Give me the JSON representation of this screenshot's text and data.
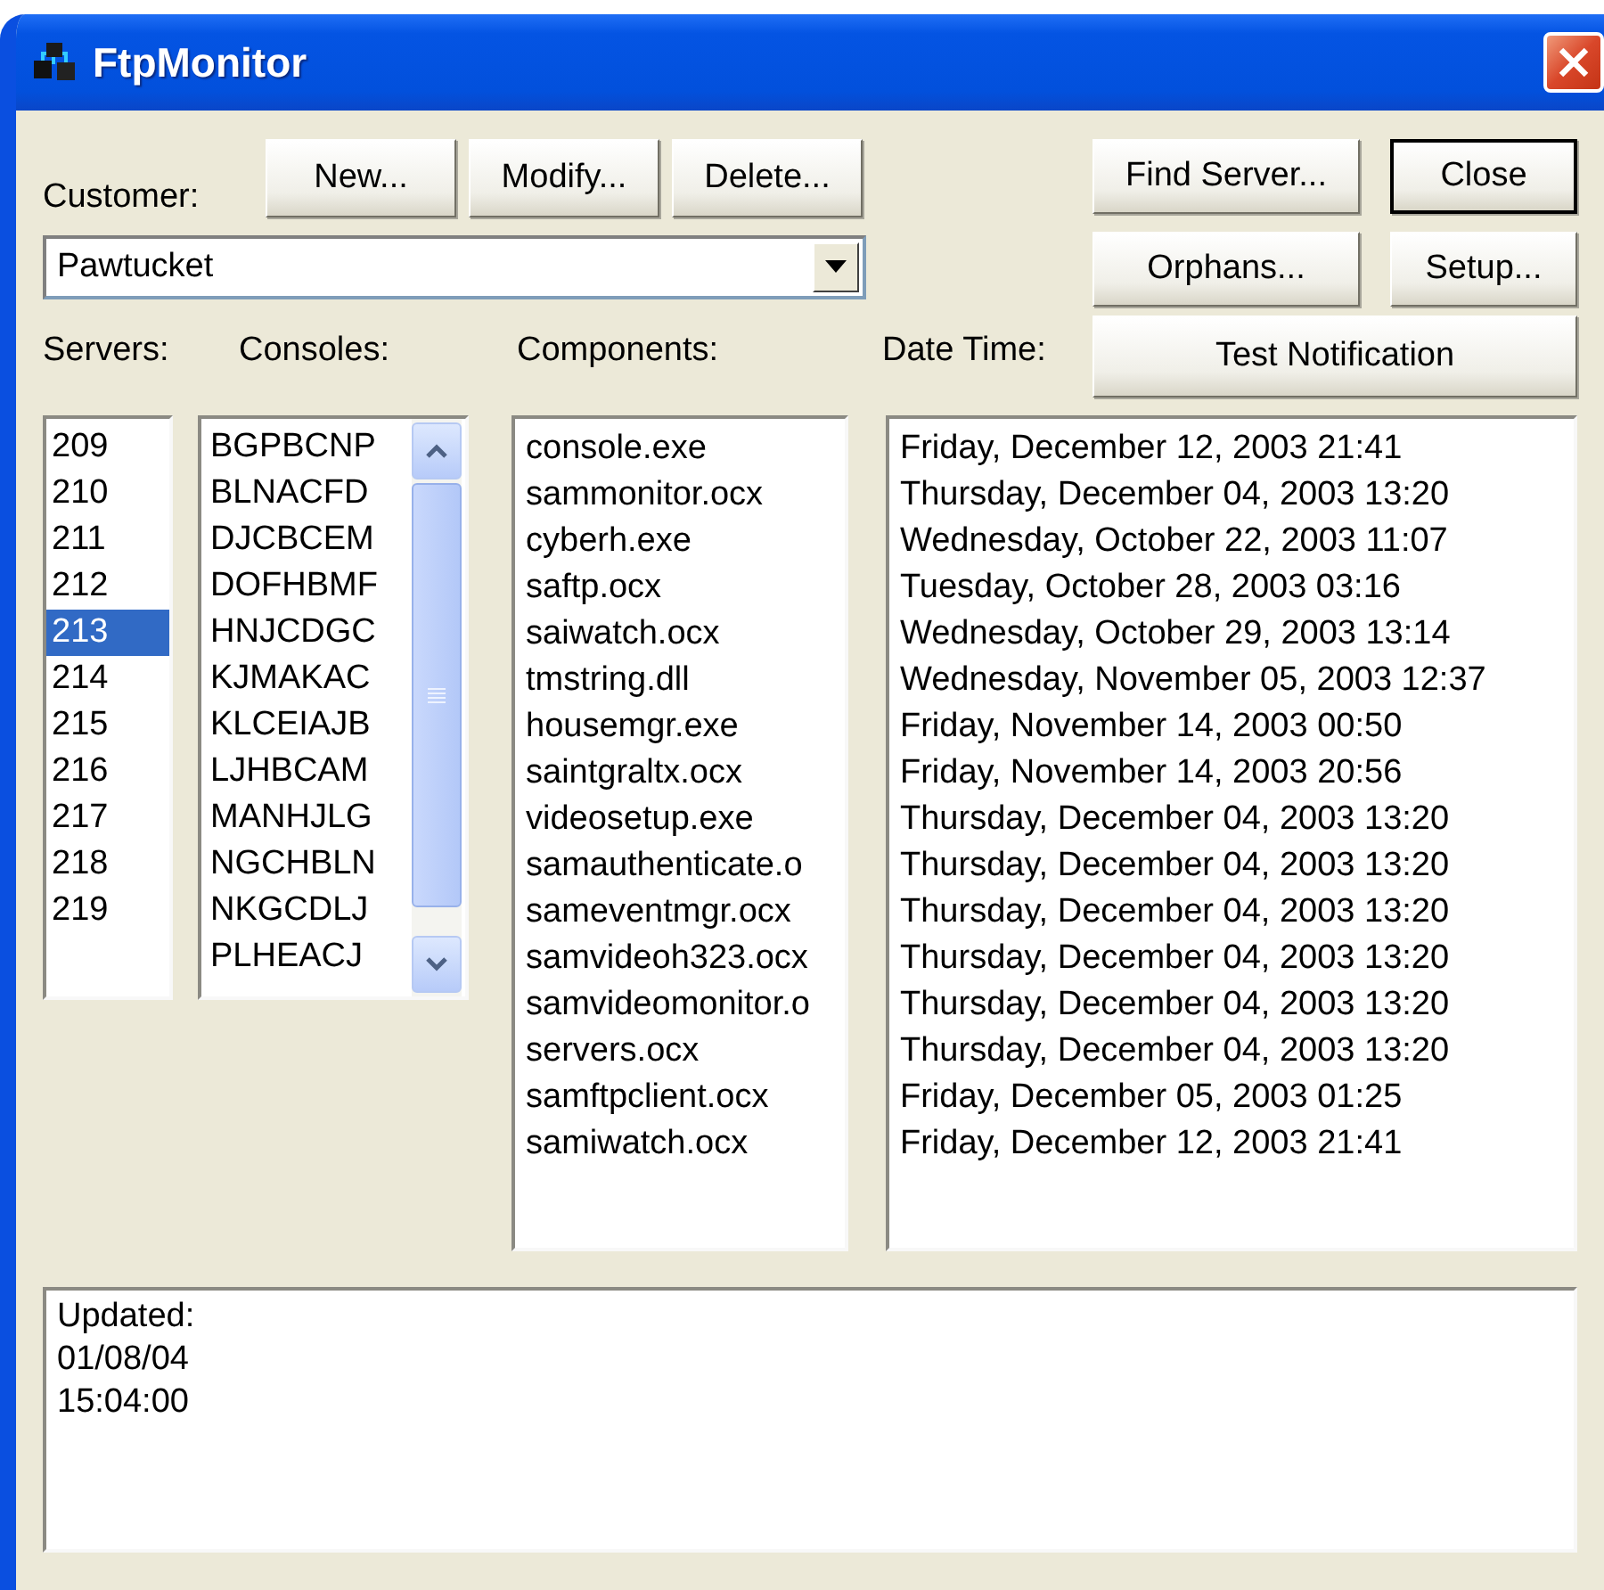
{
  "window": {
    "title": "FtpMonitor"
  },
  "customer": {
    "label": "Customer:",
    "value": "Pawtucket"
  },
  "customer_buttons": [
    {
      "label": "New..."
    },
    {
      "label": "Modify..."
    },
    {
      "label": "Delete..."
    }
  ],
  "action_buttons": [
    {
      "label": "Find Server...",
      "default": false
    },
    {
      "label": "Close",
      "default": true
    },
    {
      "label": "Orphans...",
      "default": false
    },
    {
      "label": "Setup...",
      "default": false
    },
    {
      "label": "Test Notification",
      "default": false
    }
  ],
  "servers": {
    "label": "Servers:",
    "items": [
      {
        "text": "209",
        "selected": false
      },
      {
        "text": "210",
        "selected": false
      },
      {
        "text": "211",
        "selected": false
      },
      {
        "text": "212",
        "selected": false
      },
      {
        "text": "213",
        "selected": true
      },
      {
        "text": "214",
        "selected": false
      },
      {
        "text": "215",
        "selected": false
      },
      {
        "text": "216",
        "selected": false
      },
      {
        "text": "217",
        "selected": false
      },
      {
        "text": "218",
        "selected": false
      },
      {
        "text": "219",
        "selected": false
      }
    ]
  },
  "consoles": {
    "label": "Consoles:",
    "items": [
      "BGPBCNP",
      "BLNACFD",
      "DJCBCEM",
      "DOFHBMF",
      "HNJCDGC",
      "KJMAKAC",
      "KLCEIAJB",
      "LJHBCAM",
      "MANHJLG",
      "NGCHBLN",
      "NKGCDLJ",
      "PLHEACJ"
    ]
  },
  "components": {
    "label": "Components:",
    "items": [
      "console.exe",
      "sammonitor.ocx",
      "cyberh.exe",
      "saftp.ocx",
      "saiwatch.ocx",
      "tmstring.dll",
      "housemgr.exe",
      "saintgraltx.ocx",
      "videosetup.exe",
      "samauthenticate.o",
      "sameventmgr.ocx",
      "samvideoh323.ocx",
      "samvideomonitor.o",
      "servers.ocx",
      "samftpclient.ocx",
      "samiwatch.ocx"
    ]
  },
  "date_time": {
    "label": "Date Time:",
    "items": [
      "Friday, December 12, 2003 21:41",
      "Thursday, December 04, 2003 13:20",
      "Wednesday, October 22, 2003 11:07",
      "Tuesday, October 28, 2003 03:16",
      "Wednesday, October 29, 2003 13:14",
      "Wednesday, November 05, 2003 12:37",
      "Friday, November 14, 2003 00:50",
      "Friday, November 14, 2003 20:56",
      "Thursday, December 04, 2003 13:20",
      "Thursday, December 04, 2003 13:20",
      "Thursday, December 04, 2003 13:20",
      "Thursday, December 04, 2003 13:20",
      "Thursday, December 04, 2003 13:20",
      "Thursday, December 04, 2003 13:20",
      "Friday, December 05, 2003 01:25",
      "Friday, December 12, 2003 21:41"
    ]
  },
  "status": {
    "lines": [
      "Updated:",
      "01/08/04",
      "15:04:00"
    ]
  }
}
